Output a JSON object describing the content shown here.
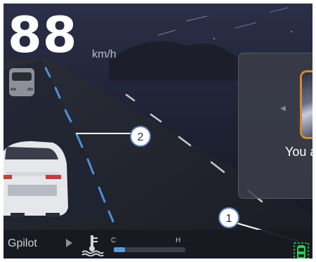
{
  "speed": {
    "value": "88",
    "unit": "km/h"
  },
  "media_panel": {
    "text": "You a"
  },
  "bottom_bar": {
    "mode_label": "Gpilot",
    "temp_gauge": {
      "cold_label": "C",
      "hot_label": "H",
      "level": 0.16
    }
  },
  "callouts": {
    "one": "1",
    "two": "2"
  },
  "colors": {
    "background": "#181b28",
    "lane_marking": "#4f92d6",
    "car_indicator": "#34c759",
    "panel_accent": "#d38a2e",
    "gauge_fill": "#5c9bd6"
  }
}
